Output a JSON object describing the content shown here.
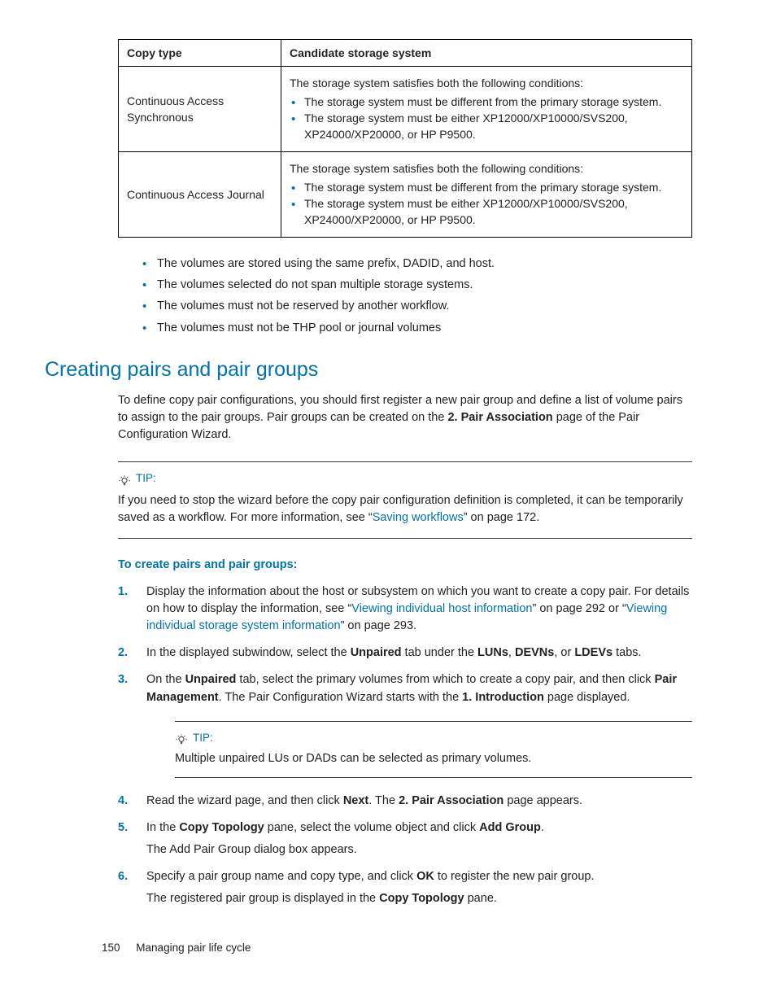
{
  "table": {
    "head": {
      "col1": "Copy type",
      "col2": "Candidate storage system"
    },
    "rows": [
      {
        "label": "Continuous Access Synchronous",
        "intro": "The storage system satisfies both the following conditions:",
        "items": [
          "The storage system must be different from the primary storage system.",
          "The storage system must be either XP12000/XP10000/SVS200, XP24000/XP20000, or HP P9500."
        ]
      },
      {
        "label": "Continuous Access Journal",
        "intro": "The storage system satisfies both the following conditions:",
        "items": [
          "The storage system must be different from the primary storage system.",
          "The storage system must be either XP12000/XP10000/SVS200, XP24000/XP20000, or HP P9500."
        ]
      }
    ]
  },
  "bullets": [
    "The volumes are stored using the same prefix, DADID, and host.",
    "The volumes selected do not span multiple storage systems.",
    "The volumes must not be reserved by another workflow.",
    "The volumes must not be THP pool or journal volumes"
  ],
  "section_title": "Creating pairs and pair groups",
  "intro": {
    "p1a": "To define copy pair configurations, you should first register a new pair group and define a list of volume pairs to assign to the pair groups. Pair groups can be created on the ",
    "b1": "2. Pair Association",
    "p1b": " page of the Pair Configuration Wizard."
  },
  "tip1": {
    "label": "TIP:",
    "t1": "If you need to stop the wizard before the copy pair configuration definition is completed, it can be temporarily saved as a workflow. For more information, see “",
    "link": "Saving workflows",
    "t2": "” on page 172."
  },
  "subhead": "To create pairs and pair groups:",
  "steps": {
    "s1": {
      "a": "Display the information about the host or subsystem on which you want to create a copy pair. For details on how to display the information, see “",
      "l1": "Viewing individual host information",
      "b": "” on page 292 or “",
      "l2": "Viewing individual storage system information",
      "c": "” on page 293."
    },
    "s2": {
      "a": "In the displayed subwindow, select the ",
      "b1": "Unpaired",
      "b": " tab under the ",
      "b2": "LUNs",
      "c": ", ",
      "b3": "DEVNs",
      "d": ", or ",
      "b4": "LDEVs",
      "e": " tabs."
    },
    "s3": {
      "a": "On the ",
      "b1": "Unpaired",
      "b": " tab, select the primary volumes from which to create a copy pair, and then click ",
      "b2": "Pair Management",
      "c": ". The Pair Configuration Wizard starts with the ",
      "b3": "1. Introduction",
      "d": " page displayed."
    },
    "tip2": {
      "label": "TIP:",
      "text": "Multiple unpaired LUs or DADs can be selected as primary volumes."
    },
    "s4": {
      "a": "Read the wizard page, and then click ",
      "b1": "Next",
      "b": ". The ",
      "b2": "2. Pair Association",
      "c": " page appears."
    },
    "s5": {
      "a": "In the ",
      "b1": "Copy Topology",
      "b": " pane, select the volume object and click ",
      "b2": "Add Group",
      "c": ".",
      "sub": "The Add Pair Group dialog box appears."
    },
    "s6": {
      "a": "Specify a pair group name and copy type, and click ",
      "b1": "OK",
      "b": " to register the new pair group.",
      "sub1": "The registered pair group is displayed in the ",
      "sub_b": "Copy Topology",
      "sub2": " pane."
    }
  },
  "footer": {
    "page": "150",
    "chapter": "Managing pair life cycle"
  }
}
